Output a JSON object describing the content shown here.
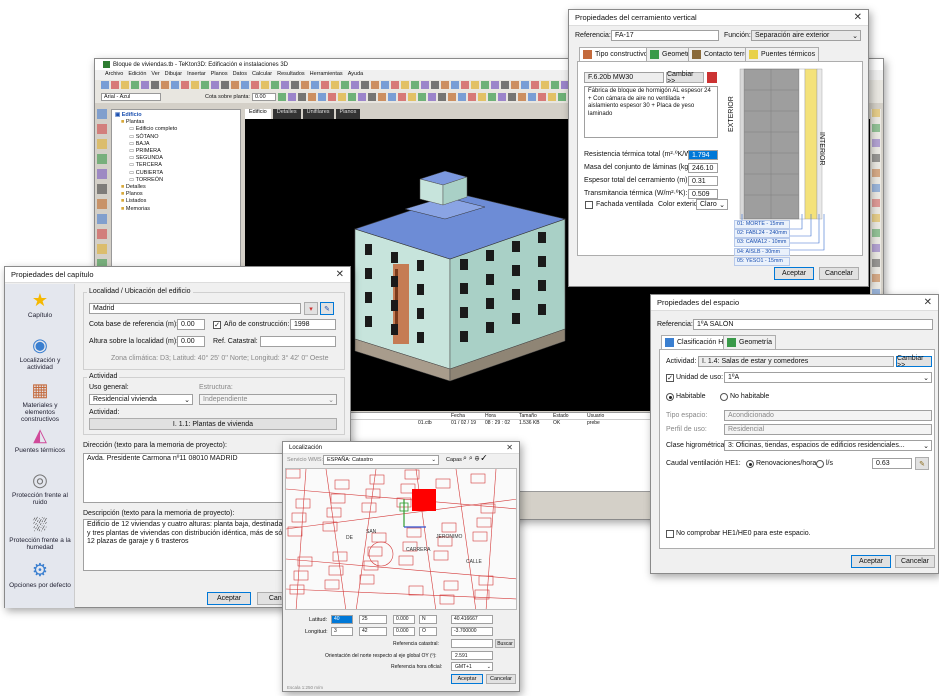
{
  "main_window": {
    "title": "Bloque de viviendas.tb - TeKton3D: Edificación e instalaciones 3D",
    "menu": [
      "Archivo",
      "Edición",
      "Ver",
      "Dibujar",
      "Insertar",
      "Planos",
      "Datos",
      "Calcular",
      "Resultados",
      "Herramientas",
      "Ayuda"
    ],
    "toolbar_font": "Arial - Azul",
    "toolbar_cota_label": "Cota sobre planta:",
    "toolbar_cota_value": "0.00",
    "view_tabs": [
      "Edificio",
      "Detalles",
      "Unifilares",
      "Planos"
    ],
    "tree": {
      "root": "Edificio",
      "plantas_label": "Plantas",
      "plantas": [
        "Edificio completo",
        "SÓTANO",
        "BAJA",
        "PRIMERA",
        "SEGUNDA",
        "TERCERA",
        "CUBIERTA",
        "TORREÓN"
      ],
      "others": [
        "Detalles",
        "Planos",
        "Listados",
        "Memorias"
      ]
    },
    "file_table": {
      "headers": [
        "Fecha",
        "Hora",
        "Tamaño",
        "Estado",
        "Usuario"
      ],
      "row": [
        "01 / 02 / 19",
        "08 : 29 : 02",
        "1.536 KB",
        "OK",
        "prebe"
      ],
      "row_prefix": "01.ctb"
    }
  },
  "cerramiento": {
    "title": "Propiedades del cerramiento vertical",
    "ref_label": "Referencia:",
    "ref_value": "FA-17",
    "funcion_label": "Función:",
    "funcion_value": "Separación aire exterior",
    "tabs": [
      "Tipo constructivo",
      "Geometría",
      "Contacto terreno",
      "Puentes térmicos"
    ],
    "tipo_code": "F.6.20b MW30",
    "cambiar": "Cambiar >>",
    "description": "Fábrica de bloque de hormigón AL espesor 24 + Con cámara de aire no ventilada + aislamiento espesor 30 + Placa de yeso laminado",
    "props": [
      {
        "label": "Resistencia térmica total (m²·ºK/W):",
        "value": "1.794"
      },
      {
        "label": "Masa del conjunto de láminas (kg/m²):",
        "value": "246.10"
      },
      {
        "label": "Espesor total del cerramiento (m):",
        "value": "0.31"
      },
      {
        "label": "Transmitancia térmica (W/m²·ºK):",
        "value": "0.509"
      }
    ],
    "fachada_label": "Fachada ventilada",
    "color_label": "Color exterior:",
    "color_value": "Claro",
    "exterior": "EXTERIOR",
    "interior": "INTERIOR",
    "layers": [
      "01: MORTE - 15mm",
      "02: FABL24 - 240mm",
      "03: CAMA12 - 10mm",
      "04: AISLB - 30mm",
      "05: YESO1 - 15mm"
    ],
    "aceptar": "Aceptar",
    "cancelar": "Cancelar"
  },
  "capitulo": {
    "title": "Propiedades del capítulo",
    "sidebar": [
      "Capítulo",
      "Localización y actividad",
      "Materiales y elementos constructivos",
      "Puentes térmicos",
      "Protección frente al ruido",
      "Protección frente a la humedad",
      "Opciones por defecto"
    ],
    "loc_group": "Localidad / Ubicación del edificio",
    "localidad": "Madrid",
    "cota_label": "Cota base de referencia (m):",
    "cota_value": "0.00",
    "anio_label": "Año de construcción:",
    "anio_value": "1998",
    "altura_label": "Altura sobre la localidad (m):",
    "altura_value": "0.00",
    "catastral_label": "Ref. Catastral:",
    "zona": "Zona climática: D3; Latitud: 40° 25' 0'' Norte; Longitud: 3° 42' 0'' Oeste",
    "actividad_group": "Actividad",
    "uso_label": "Uso general:",
    "uso_value": "Residencial vivienda",
    "estructura_label": "Estructura:",
    "estructura_value": "Independiente",
    "actividad_label": "Actividad:",
    "actividad_value": "I. 1.1: Plantas de vivienda",
    "direccion_label": "Dirección (texto para la memoria de proyecto):",
    "direccion_value": "Avda. Presidente Carmona nº11 08010 MADRID",
    "descripcion_label": "Descripción (texto para la memoria de proyecto):",
    "descripcion_value": "Edificio de 12 viviendas y cuatro alturas: planta baja, destinada a lo comerciales, y tres plantas de viviendas con distribución idéntica, más de sótano que alberga 12 plazas de garaje y 6 trasteros",
    "aceptar": "Aceptar",
    "cancelar": "Canc"
  },
  "localizacion": {
    "title": "Localización",
    "servicio_label": "Servicio WMS:",
    "servicio_value": "ESPAÑA: Catastro",
    "capas_label": "Capas",
    "latitud_label": "Latitud:",
    "latitud": [
      "40",
      "25",
      "0.000",
      "N",
      "40.416667"
    ],
    "longitud_label": "Longitud:",
    "longitud": [
      "3",
      "42",
      "0.000",
      "O",
      "-3.700000"
    ],
    "catastral_label": "Referencia catastral:",
    "buscar": "Buscar",
    "orientacion_label": "Orientación del norte respecto al eje global OY (º):",
    "orientacion_value": "2.591",
    "hora_label": "Referencia hora oficial:",
    "hora_value": "GMT+1",
    "aceptar": "Aceptar",
    "cancelar": "Cancelar",
    "escala": "Escala 1:250 m/m",
    "streets": [
      "CARRERA",
      "DE",
      "SAN",
      "JERONIMO",
      "CALLE"
    ]
  },
  "espacio": {
    "title": "Propiedades del espacio",
    "ref_label": "Referencia:",
    "ref_value": "1ºA SALÓN",
    "tabs": [
      "Clasificación HE1",
      "Geometría"
    ],
    "actividad_label": "Actividad:",
    "actividad_value": "I. 1.4: Salas de estar y comedores",
    "cambiar": "Cambiar >>",
    "unidad_label": "Unidad de uso:",
    "unidad_value": "1ºA",
    "habitable": "Habitable",
    "no_habitable": "No habitable",
    "tipo_label": "Tipo espacio:",
    "tipo_value": "Acondicionado",
    "perfil_label": "Perfil de uso:",
    "perfil_value": "Residencial",
    "clase_label": "Clase higrométrica:",
    "clase_value": "3: Oficinas, tiendas, espacios de edificios residenciales...",
    "caudal_label": "Caudal ventilación HE1:",
    "renov_label": "Renovaciones/hora",
    "ls_label": "l/s",
    "caudal_value": "0.63",
    "no_comprobar": "No comprobar HE1/HE0 para este espacio.",
    "aceptar": "Aceptar",
    "cancelar": "Cancelar"
  },
  "colors": {
    "accent": "#0078d7",
    "title_blue": "#1a4fb0",
    "viewport": "#000000",
    "roof": "#6d8cd6",
    "wall": "#b9ddd3",
    "brick": "#c46a3c",
    "building_red": "#ff0000"
  }
}
